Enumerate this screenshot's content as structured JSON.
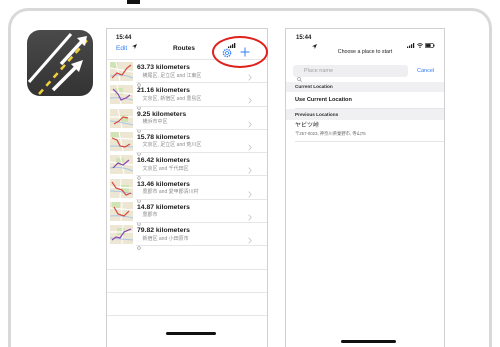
{
  "left_phone": {
    "status_time": "15:44",
    "nav": {
      "edit_label": "Edit",
      "title": "Routes"
    },
    "routes": [
      {
        "distance": "63.73 kilometers",
        "area": "横尾区, 足立区 and 江東区"
      },
      {
        "distance": "21.16 kilometers",
        "area": "文京区, 新宿区 and 豊島区"
      },
      {
        "distance": "9.25 kilometers",
        "area": "横浜市中区"
      },
      {
        "distance": "15.78 kilometers",
        "area": "文京区, 足立区 and 荒川区"
      },
      {
        "distance": "16.42 kilometers",
        "area": "文京区 and 千代田区"
      },
      {
        "distance": "13.46 kilometers",
        "area": "豊郡市 and 愛甲郡清川村"
      },
      {
        "distance": "14.87 kilometers",
        "area": "豊郡市"
      },
      {
        "distance": "79.82 kilometers",
        "area": "新宿区 and 小田原市"
      }
    ]
  },
  "right_phone": {
    "status_time": "15:44",
    "title": "Choose a place to start",
    "search": {
      "placeholder": "Place name",
      "cancel_label": "Cancel"
    },
    "current_location_header": "Current Location",
    "use_current_location": "Use Current Location",
    "previous_locations_header": "Previous Locations",
    "previous_locations": [
      {
        "name": "ヤビツ峠",
        "address": "〒257-0023, 神奈川県秦野市, 寺山75"
      }
    ]
  },
  "icons": {
    "app": "road-arrows-icon",
    "settings": "gear-icon",
    "add": "plus-icon",
    "location": "location-arrow-icon",
    "row_place": "map-pin-icon",
    "row_disclosure": "chevron-right-icon",
    "search": "search-icon"
  },
  "colors": {
    "accent": "#2f7df6",
    "highlight": "#e0201c",
    "app_icon_bg": "#3d3d3d",
    "road_line": "#f2d13c"
  }
}
